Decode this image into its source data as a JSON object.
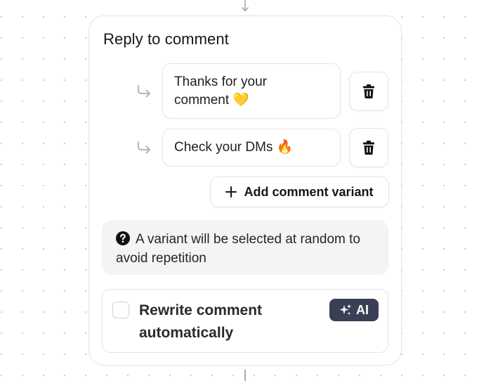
{
  "card": {
    "title": "Reply to comment",
    "variants": [
      {
        "line1": "Thanks for your",
        "line2": "comment 💛"
      },
      {
        "line1": "Check your DMs 🔥"
      }
    ],
    "add_variant_label": "Add comment variant",
    "info_text": "A variant will be selected at random to avoid repetition",
    "rewrite": {
      "label": "Rewrite comment automatically",
      "checked": false,
      "badge": "AI"
    }
  },
  "colors": {
    "badge_bg": "#3a3f55",
    "border": "#e4e4e7",
    "info_bg": "#f4f4f5",
    "canvas_dots": "#c9c9cc"
  }
}
